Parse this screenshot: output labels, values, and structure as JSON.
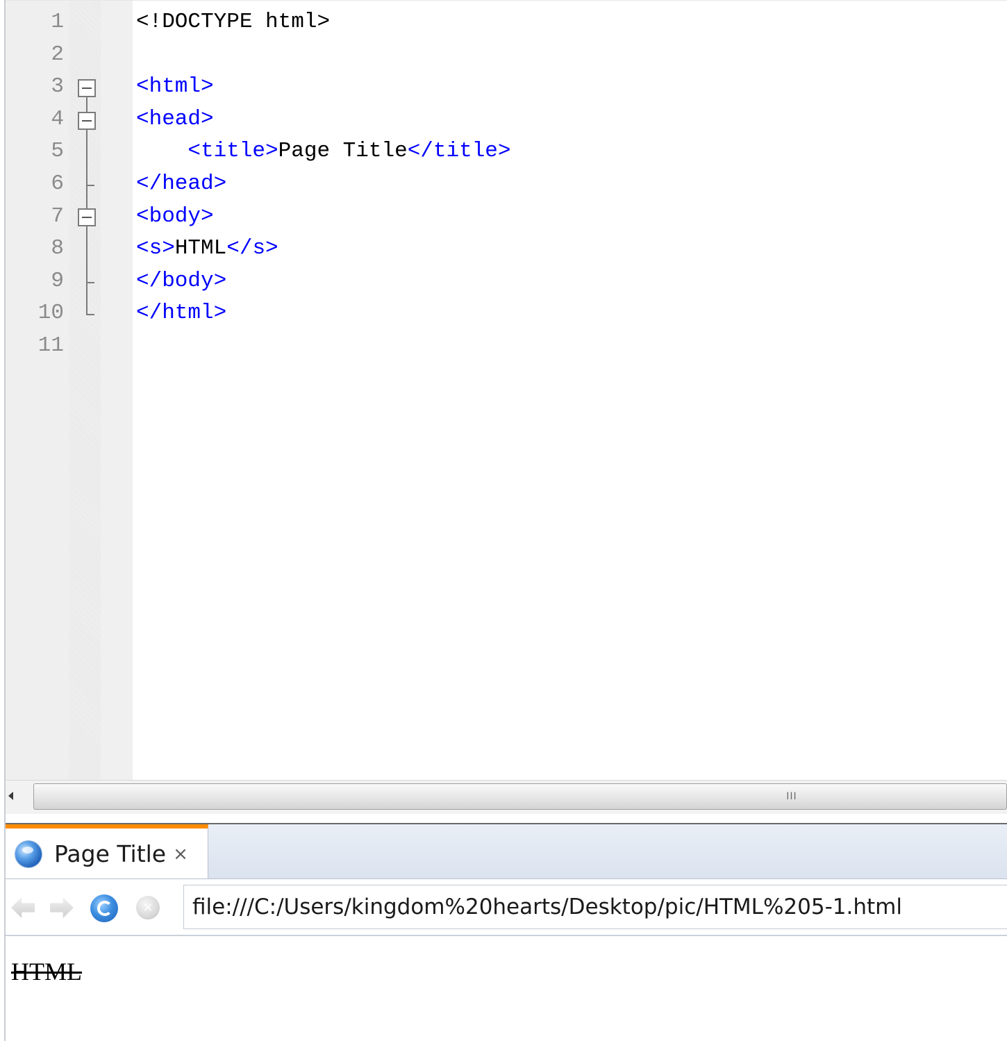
{
  "editor": {
    "line_numbers": [
      "1",
      "2",
      "3",
      "4",
      "5",
      "6",
      "7",
      "8",
      "9",
      "10",
      "11"
    ],
    "lines": [
      {
        "tokens": [
          {
            "t": "<!DOCTYPE html>",
            "k": "text"
          }
        ]
      },
      {
        "tokens": []
      },
      {
        "tokens": [
          {
            "t": "<html>",
            "k": "tag"
          }
        ]
      },
      {
        "tokens": [
          {
            "t": "<head>",
            "k": "tag"
          }
        ]
      },
      {
        "tokens": [
          {
            "t": "    ",
            "k": "text"
          },
          {
            "t": "<title>",
            "k": "tag"
          },
          {
            "t": "Page Title",
            "k": "text"
          },
          {
            "t": "</title>",
            "k": "tag"
          }
        ]
      },
      {
        "tokens": [
          {
            "t": "</head>",
            "k": "tag"
          }
        ]
      },
      {
        "tokens": [
          {
            "t": "<body>",
            "k": "tag"
          }
        ]
      },
      {
        "tokens": [
          {
            "t": "<s>",
            "k": "tag"
          },
          {
            "t": "HTML",
            "k": "text"
          },
          {
            "t": "</s>",
            "k": "tag"
          }
        ]
      },
      {
        "tokens": [
          {
            "t": "</body>",
            "k": "tag"
          }
        ]
      },
      {
        "tokens": [
          {
            "t": "</html>",
            "k": "tag"
          }
        ]
      },
      {
        "tokens": []
      }
    ],
    "colors": {
      "tag": "#0000ff",
      "text": "#000000",
      "line_number": "#8a8a8a"
    }
  },
  "scrollbar": {
    "left_arrow_icon": "scroll-left-arrow-icon",
    "grip": "III"
  },
  "browser": {
    "tab": {
      "title": "Page Title",
      "close_label": "×",
      "icon": "globe-icon",
      "accent_color": "#ff8c00"
    },
    "nav": {
      "back_icon": "back-arrow-icon",
      "forward_icon": "forward-arrow-icon",
      "refresh_icon": "refresh-icon",
      "stop_icon": "stop-icon",
      "stop_glyph": "×"
    },
    "address": "file:///C:/Users/kingdom%20hearts/Desktop/pic/HTML%205-1.html",
    "page_content": {
      "text": "HTML",
      "style": "strikethrough"
    }
  }
}
